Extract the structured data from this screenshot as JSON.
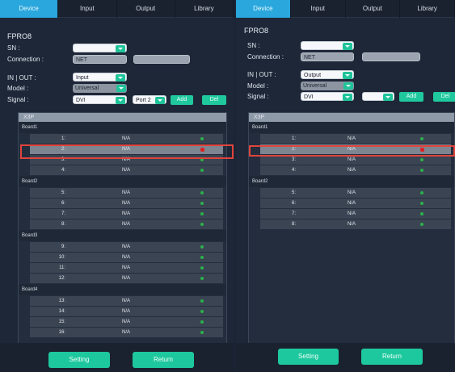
{
  "tabs": [
    "Device",
    "Input",
    "Output",
    "Library"
  ],
  "left": {
    "device": "FPRO8",
    "sn_label": "SN :",
    "connection_label": "Connection :",
    "connection_value": "NET",
    "inout_label": "IN | OUT :",
    "inout_value": "Input",
    "model_label": "Model :",
    "model_value": "Universal",
    "signal_label": "Signal :",
    "signal_value": "DVI",
    "port_value": "Port 2",
    "add_label": "Add",
    "del_label": "Del",
    "list_header": "X3P",
    "boards": [
      {
        "name": "Board1",
        "rows": [
          {
            "num": "1:",
            "status": "N/A"
          },
          {
            "num": "2:",
            "status": "N/A",
            "selected": true
          },
          {
            "num": "3:",
            "status": "N/A"
          },
          {
            "num": "4:",
            "status": "N/A"
          }
        ]
      },
      {
        "name": "Board2",
        "rows": [
          {
            "num": "5:",
            "status": "N/A"
          },
          {
            "num": "6:",
            "status": "N/A"
          },
          {
            "num": "7:",
            "status": "N/A"
          },
          {
            "num": "8:",
            "status": "N/A"
          }
        ]
      },
      {
        "name": "Board3",
        "rows": [
          {
            "num": "9:",
            "status": "N/A"
          },
          {
            "num": "10:",
            "status": "N/A"
          },
          {
            "num": "11:",
            "status": "N/A"
          },
          {
            "num": "12:",
            "status": "N/A"
          }
        ]
      },
      {
        "name": "Board4",
        "rows": [
          {
            "num": "13:",
            "status": "N/A"
          },
          {
            "num": "14:",
            "status": "N/A"
          },
          {
            "num": "15:",
            "status": "N/A"
          },
          {
            "num": "16:",
            "status": "N/A"
          }
        ]
      }
    ],
    "setting_label": "Setting",
    "return_label": "Return"
  },
  "right": {
    "device": "FPRO8",
    "sn_label": "SN :",
    "connection_label": "Connection :",
    "connection_value": "NET",
    "inout_label": "IN | OUT :",
    "inout_value": "Output",
    "model_label": "Model :",
    "model_value": "Universal",
    "signal_label": "Signal :",
    "signal_value": "DVI",
    "add_label": "Add",
    "del_label": "Del",
    "list_header": "X3P",
    "boards": [
      {
        "name": "Board1",
        "rows": [
          {
            "num": "1:",
            "status": "N/A"
          },
          {
            "num": "2:",
            "status": "N/A",
            "selected": true
          },
          {
            "num": "3:",
            "status": "N/A"
          },
          {
            "num": "4:",
            "status": "N/A"
          }
        ]
      },
      {
        "name": "Board2",
        "rows": [
          {
            "num": "5:",
            "status": "N/A"
          },
          {
            "num": "6:",
            "status": "N/A"
          },
          {
            "num": "7:",
            "status": "N/A"
          },
          {
            "num": "8:",
            "status": "N/A"
          }
        ]
      }
    ],
    "setting_label": "Setting",
    "return_label": "Return"
  },
  "colors": {
    "accent": "#1ec89e",
    "tab_active": "#2aa7dc",
    "status_ok": "#2bb24a",
    "status_sel": "#e02020",
    "highlight": "#e0443c"
  }
}
